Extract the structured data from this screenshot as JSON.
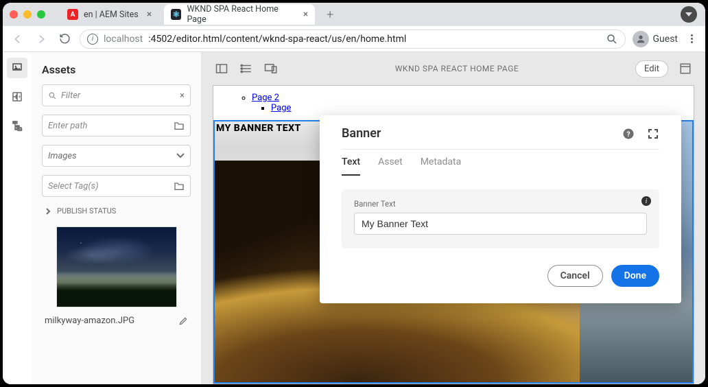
{
  "browser": {
    "tabs": [
      {
        "label": "en | AEM Sites",
        "favicon_bg": "#ed2224",
        "favicon_text": "A",
        "active": false
      },
      {
        "label": "WKND SPA React Home Page",
        "favicon_bg": "#20232a",
        "favicon_text": "⚛",
        "active": true
      }
    ],
    "url_gray_prefix": "localhost",
    "url_black": ":4502/editor.html/content/wknd-spa-react/us/en/home.html",
    "guest_label": "Guest"
  },
  "sidepanel": {
    "heading": "Assets",
    "filter_placeholder": "Filter",
    "path_placeholder": "Enter path",
    "type_selected": "Images",
    "tags_placeholder": "Select Tag(s)",
    "publish_status_label": "PUBLISH STATUS",
    "asset_filename": "milkyway-amazon.JPG"
  },
  "editor": {
    "page_title": "WKND SPA REACT HOME PAGE",
    "edit_button": "Edit",
    "nav_links": {
      "page2": "Page 2",
      "page3_partial": "Page"
    },
    "banner_overlay_text": "MY BANNER TEXT"
  },
  "dialog": {
    "title": "Banner",
    "tabs": {
      "text": "Text",
      "asset": "Asset",
      "metadata": "Metadata"
    },
    "field_label": "Banner Text",
    "field_value": "My Banner Text",
    "cancel": "Cancel",
    "done": "Done"
  }
}
